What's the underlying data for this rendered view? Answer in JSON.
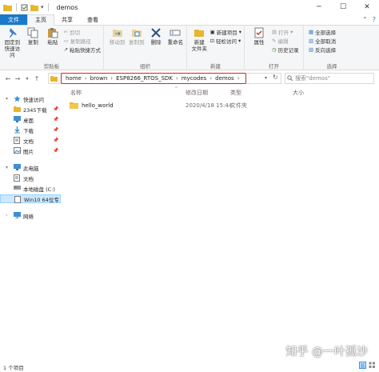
{
  "window": {
    "title": "demos"
  },
  "tabs": [
    "文件",
    "主页",
    "共享",
    "查看"
  ],
  "ribbon": {
    "clipboard": {
      "label": "剪贴板",
      "pin": "固定到\n快速访问",
      "copy": "复制",
      "paste": "粘贴",
      "cut": "剪切",
      "copy_path": "复制路径",
      "paste_shortcut": "粘贴快捷方式"
    },
    "organize": {
      "label": "组织",
      "move_to": "移动到",
      "copy_to": "复制到",
      "delete": "删除",
      "rename": "重命名"
    },
    "new": {
      "label": "新建",
      "new_folder": "新建\n文件夹",
      "new_item": "新建项目",
      "easy_access": "轻松访问"
    },
    "open": {
      "label": "打开",
      "properties": "属性",
      "open": "打开",
      "edit": "编辑",
      "history": "历史记录"
    },
    "select": {
      "label": "选择",
      "select_all": "全部选择",
      "select_none": "全部取消",
      "invert": "反向选择"
    }
  },
  "address": {
    "crumbs": [
      "home",
      "brown",
      "ESP8266_RTOS_SDK",
      "mycodes",
      "demos"
    ],
    "search_placeholder": "搜索\"demos\""
  },
  "columns": {
    "name": "名称",
    "date": "修改日期",
    "type": "类型",
    "size": "大小"
  },
  "files": [
    {
      "name": "hello_world",
      "date": "2020/4/18 15:44",
      "type": "文件夹",
      "size": ""
    }
  ],
  "nav": {
    "quick_access": "快速访问",
    "downloads_2345": "2345下载",
    "desktop": "桌面",
    "downloads": "下载",
    "documents": "文档",
    "pictures": "图片",
    "this_pc": "此电脑",
    "pc_documents": "文档",
    "local_disk": "本地磁盘 (C:)",
    "win10": "Win10 64位专",
    "network": "网络"
  },
  "status": {
    "item_count": "1 个项目"
  },
  "watermark": "知乎 @一叶孤沙",
  "colors": {
    "accent": "#1979ca",
    "highlight": "#d7261e",
    "folder": "#e8b62e"
  }
}
